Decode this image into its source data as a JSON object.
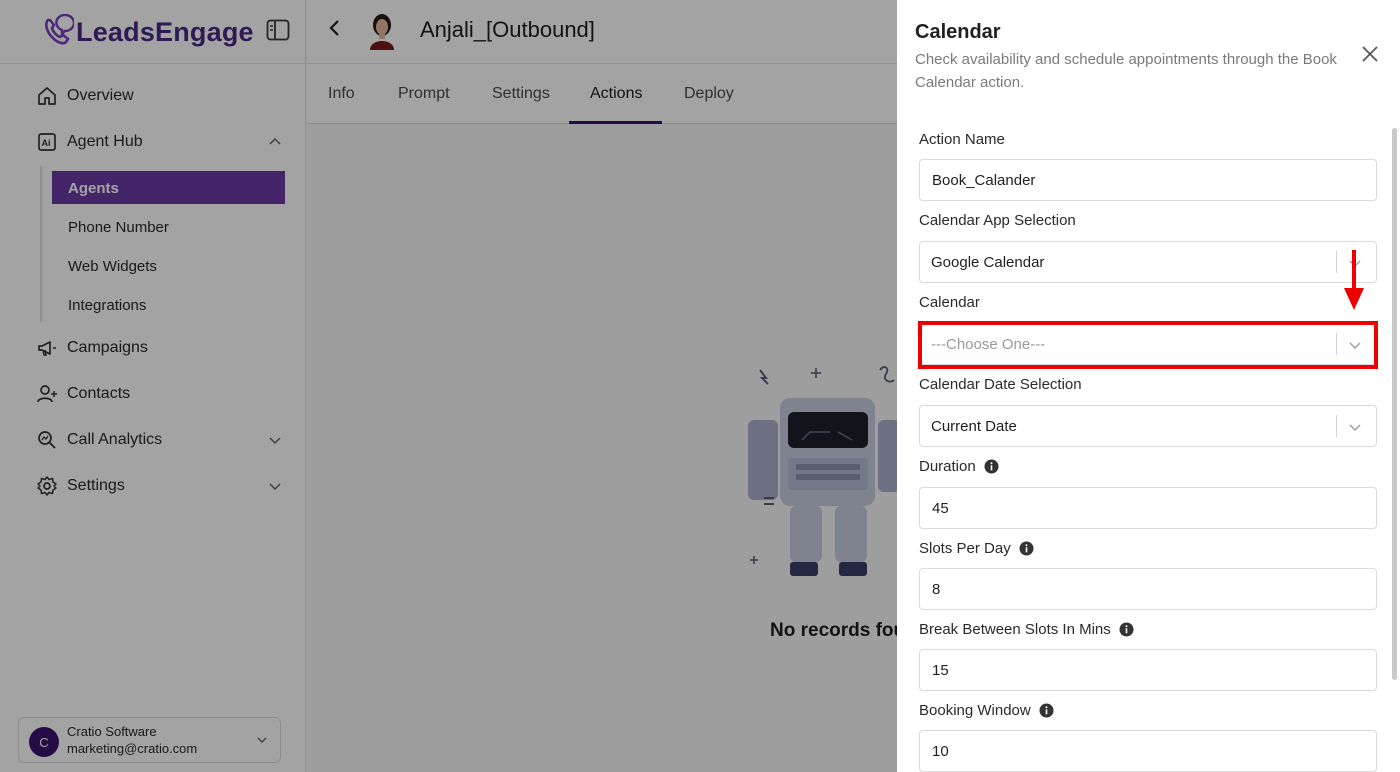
{
  "app": {
    "brand": "LeadsEngage"
  },
  "sidebar": {
    "items": [
      {
        "label": "Overview"
      },
      {
        "label": "Agent Hub"
      },
      {
        "label": "Campaigns"
      },
      {
        "label": "Contacts"
      },
      {
        "label": "Call Analytics"
      },
      {
        "label": "Settings"
      }
    ],
    "sub_items": [
      {
        "label": "Agents"
      },
      {
        "label": "Phone Number"
      },
      {
        "label": "Web Widgets"
      },
      {
        "label": "Integrations"
      }
    ],
    "account": {
      "initial": "C",
      "name": "Cratio Software",
      "email": "marketing@cratio.com"
    }
  },
  "header": {
    "agent_name": "Anjali_[Outbound]"
  },
  "tabs": [
    {
      "label": "Info"
    },
    {
      "label": "Prompt"
    },
    {
      "label": "Settings"
    },
    {
      "label": "Actions"
    },
    {
      "label": "Deploy"
    }
  ],
  "content": {
    "empty_text": "No records found"
  },
  "drawer": {
    "title": "Calendar",
    "subtitle": "Check availability and schedule appointments through the Book Calendar action.",
    "fields": {
      "action_name": {
        "label": "Action Name",
        "value": "Book_Calander"
      },
      "calendar_app": {
        "label": "Calendar App Selection",
        "value": "Google Calendar"
      },
      "calendar": {
        "label": "Calendar",
        "placeholder": "---Choose One---"
      },
      "date_selection": {
        "label": "Calendar Date Selection",
        "value": "Current Date"
      },
      "duration": {
        "label": "Duration",
        "value": "45"
      },
      "slots_per_day": {
        "label": "Slots Per Day",
        "value": "8"
      },
      "break_between": {
        "label": "Break Between Slots In Mins",
        "value": "15"
      },
      "booking_window": {
        "label": "Booking Window",
        "value": "10"
      }
    }
  },
  "colors": {
    "brand": "#4b2a85",
    "active_nav": "#6c3ba6",
    "highlight": "#ee0000"
  }
}
